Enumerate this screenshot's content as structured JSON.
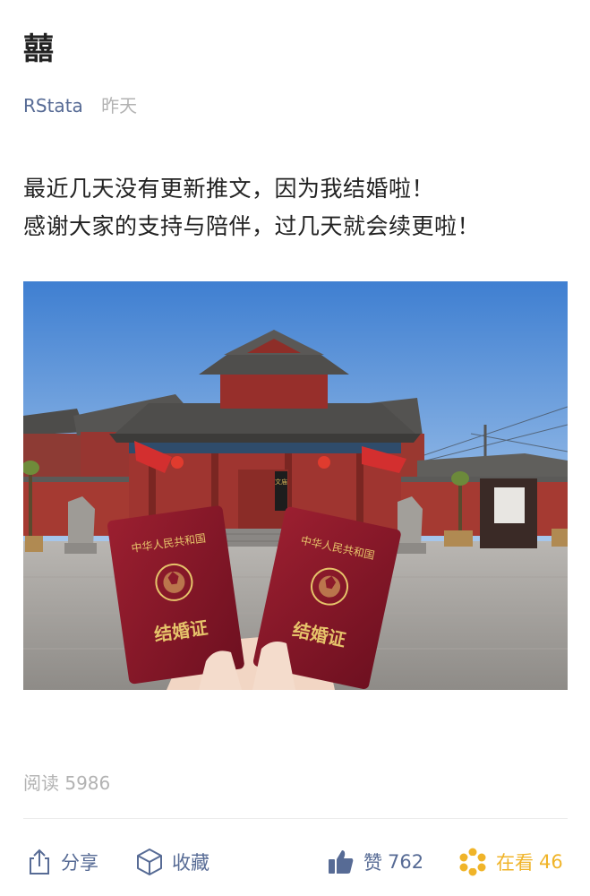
{
  "article": {
    "title": "囍",
    "author": "RStata",
    "time": "昨天",
    "paragraphs": [
      "最近几天没有更新推文，因为我结婚啦！",
      "感谢大家的支持与陪伴，过几天就会续更啦！"
    ],
    "reads_label": "阅读 5986"
  },
  "photo": {
    "certificate_header": "中华人民共和国",
    "certificate_title": "结婚证",
    "plaque_text": "文庙"
  },
  "actions": {
    "share": {
      "label": "分享",
      "icon": "share-icon"
    },
    "favorite": {
      "label": "收藏",
      "icon": "cube-icon"
    },
    "like": {
      "label": "赞",
      "count": "762",
      "icon": "thumbs-up-icon"
    },
    "watching": {
      "label": "在看",
      "count": "46",
      "icon": "flower-icon"
    }
  },
  "colors": {
    "link": "#576b95",
    "muted": "#b2b2b2",
    "watch": "#f0b429",
    "certificate_red": "#8b1a2a",
    "sky": "#5d92d3"
  }
}
